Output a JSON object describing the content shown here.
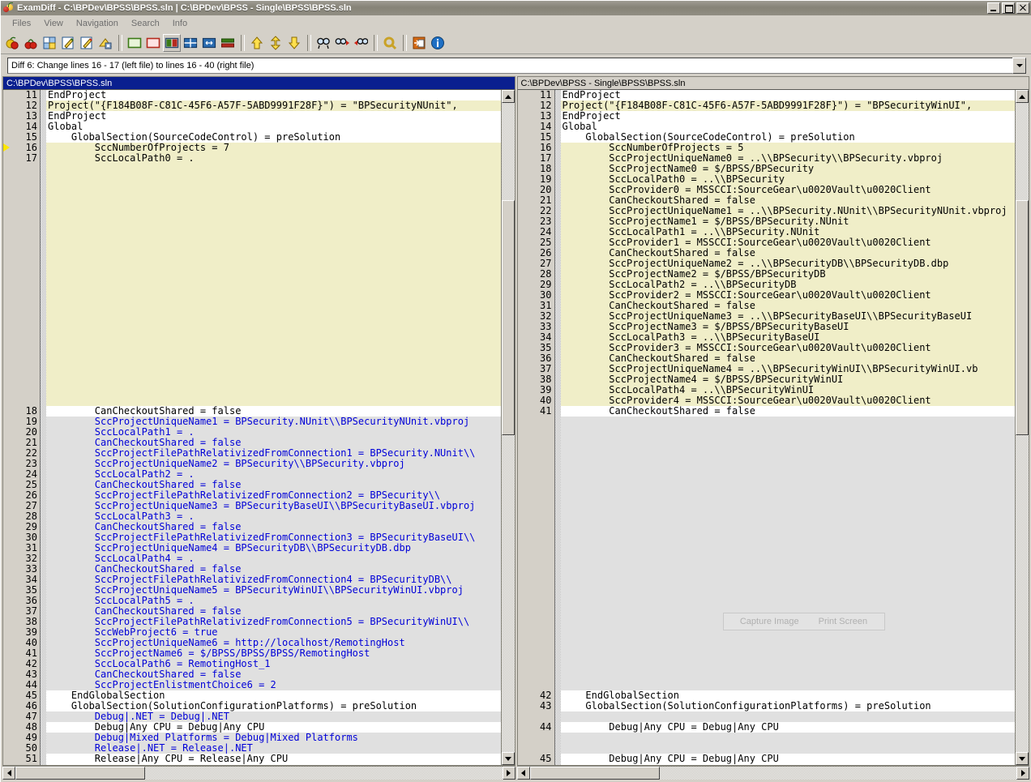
{
  "window": {
    "title": "ExamDiff - C:\\BPDev\\BPSS\\BPSS.sln  |  C:\\BPDev\\BPSS - Single\\BPSS\\BPSS.sln",
    "minimize_label": "Minimize",
    "maximize_label": "Maximize",
    "close_label": "Close"
  },
  "menu": {
    "items": [
      {
        "label": "Files"
      },
      {
        "label": "View"
      },
      {
        "label": "Navigation"
      },
      {
        "label": "Search"
      },
      {
        "label": "Info"
      }
    ]
  },
  "toolbar": {
    "buttons": [
      {
        "name": "compare-files-icon",
        "title": "Compare Files"
      },
      {
        "name": "compare-directories-icon",
        "title": "Compare Directories"
      },
      {
        "name": "recompare-icon",
        "title": "Recompare"
      },
      {
        "name": "edit-left-file-icon",
        "title": "Edit Left File"
      },
      {
        "name": "edit-right-file-icon",
        "title": "Edit Right File"
      },
      {
        "name": "save-icon",
        "title": "Save"
      },
      {
        "name": "view-left-only-icon",
        "title": "View Left File Only"
      },
      {
        "name": "view-right-only-icon",
        "title": "View Right File Only"
      },
      {
        "name": "view-side-by-side-icon",
        "title": "Side-by-Side View"
      },
      {
        "name": "view-grid-icon",
        "title": "Grid View"
      },
      {
        "name": "view-horizontal-split-icon",
        "title": "Horizontal Split"
      },
      {
        "name": "view-stacked-icon",
        "title": "Stacked View"
      },
      {
        "name": "first-diff-icon",
        "title": "First Difference"
      },
      {
        "name": "next-diff-icon",
        "title": "Next Difference"
      },
      {
        "name": "last-diff-icon",
        "title": "Last Difference"
      },
      {
        "name": "find-icon",
        "title": "Find"
      },
      {
        "name": "find-next-icon",
        "title": "Find Next"
      },
      {
        "name": "find-previous-icon",
        "title": "Find Previous"
      },
      {
        "name": "options-icon",
        "title": "Options"
      },
      {
        "name": "exit-icon",
        "title": "Exit"
      },
      {
        "name": "about-icon",
        "title": "About"
      }
    ],
    "selected_index": 8
  },
  "diff_status": {
    "text": "Diff 6: Change lines 16 - 17 (left file) to lines 16 - 40 (right file)"
  },
  "left_pane": {
    "path": "C:\\BPDev\\BPSS\\BPSS.sln",
    "active": true,
    "lines": [
      {
        "n": "11",
        "text": "EndProject",
        "type": "same"
      },
      {
        "n": "12",
        "text": "Project(\"{F184B08F-C81C-45F6-A57F-5ABD9991F28F}\") = \"BPSecurityNUnit\",",
        "type": "inline"
      },
      {
        "n": "13",
        "text": "EndProject",
        "type": "same"
      },
      {
        "n": "14",
        "text": "Global",
        "type": "same"
      },
      {
        "n": "15",
        "text": "    GlobalSection(SourceCodeControl) = preSolution",
        "type": "same"
      },
      {
        "n": "16",
        "text": "        SccNumberOfProjects = 7",
        "type": "chg"
      },
      {
        "n": "17",
        "text": "        SccLocalPath0 = .",
        "type": "chg"
      },
      {
        "n": "18",
        "text": "        CanCheckoutShared = false",
        "type": "same"
      },
      {
        "n": "19",
        "text": "        SccProjectUniqueName1 = BPSecurity.NUnit\\\\BPSecurityNUnit.vbproj",
        "type": "del"
      },
      {
        "n": "20",
        "text": "        SccLocalPath1 = .",
        "type": "del"
      },
      {
        "n": "21",
        "text": "        CanCheckoutShared = false",
        "type": "del"
      },
      {
        "n": "22",
        "text": "        SccProjectFilePathRelativizedFromConnection1 = BPSecurity.NUnit\\\\",
        "type": "del"
      },
      {
        "n": "23",
        "text": "        SccProjectUniqueName2 = BPSecurity\\\\BPSecurity.vbproj",
        "type": "del"
      },
      {
        "n": "24",
        "text": "        SccLocalPath2 = .",
        "type": "del"
      },
      {
        "n": "25",
        "text": "        CanCheckoutShared = false",
        "type": "del"
      },
      {
        "n": "26",
        "text": "        SccProjectFilePathRelativizedFromConnection2 = BPSecurity\\\\",
        "type": "del"
      },
      {
        "n": "27",
        "text": "        SccProjectUniqueName3 = BPSecurityBaseUI\\\\BPSecurityBaseUI.vbproj",
        "type": "del"
      },
      {
        "n": "28",
        "text": "        SccLocalPath3 = .",
        "type": "del"
      },
      {
        "n": "29",
        "text": "        CanCheckoutShared = false",
        "type": "del"
      },
      {
        "n": "30",
        "text": "        SccProjectFilePathRelativizedFromConnection3 = BPSecurityBaseUI\\\\",
        "type": "del"
      },
      {
        "n": "31",
        "text": "        SccProjectUniqueName4 = BPSecurityDB\\\\BPSecurityDB.dbp",
        "type": "del"
      },
      {
        "n": "32",
        "text": "        SccLocalPath4 = .",
        "type": "del"
      },
      {
        "n": "33",
        "text": "        CanCheckoutShared = false",
        "type": "del"
      },
      {
        "n": "34",
        "text": "        SccProjectFilePathRelativizedFromConnection4 = BPSecurityDB\\\\",
        "type": "del"
      },
      {
        "n": "35",
        "text": "        SccProjectUniqueName5 = BPSecurityWinUI\\\\BPSecurityWinUI.vbproj",
        "type": "del"
      },
      {
        "n": "36",
        "text": "        SccLocalPath5 = .",
        "type": "del"
      },
      {
        "n": "37",
        "text": "        CanCheckoutShared = false",
        "type": "del"
      },
      {
        "n": "38",
        "text": "        SccProjectFilePathRelativizedFromConnection5 = BPSecurityWinUI\\\\",
        "type": "del"
      },
      {
        "n": "39",
        "text": "        SccWebProject6 = true",
        "type": "del"
      },
      {
        "n": "40",
        "text": "        SccProjectUniqueName6 = http://localhost/RemotingHost",
        "type": "del"
      },
      {
        "n": "41",
        "text": "        SccProjectName6 = $/BPSS/BPSS/BPSS/RemotingHost",
        "type": "del"
      },
      {
        "n": "42",
        "text": "        SccLocalPath6 = RemotingHost_1",
        "type": "del"
      },
      {
        "n": "43",
        "text": "        CanCheckoutShared = false",
        "type": "del"
      },
      {
        "n": "44",
        "text": "        SccProjectEnlistmentChoice6 = 2",
        "type": "del"
      },
      {
        "n": "45",
        "text": "    EndGlobalSection",
        "type": "same"
      },
      {
        "n": "46",
        "text": "    GlobalSection(SolutionConfigurationPlatforms) = preSolution",
        "type": "same"
      },
      {
        "n": "47",
        "text": "        Debug|.NET = Debug|.NET",
        "type": "del"
      },
      {
        "n": "48",
        "text": "        Debug|Any CPU = Debug|Any CPU",
        "type": "same"
      },
      {
        "n": "49",
        "text": "        Debug|Mixed Platforms = Debug|Mixed Platforms",
        "type": "del"
      },
      {
        "n": "50",
        "text": "        Release|.NET = Release|.NET",
        "type": "del"
      },
      {
        "n": "51",
        "text": "        Release|Any CPU = Release|Any CPU",
        "type": "same"
      },
      {
        "n": "52",
        "text": "",
        "type": "same"
      }
    ]
  },
  "right_pane": {
    "path": "C:\\BPDev\\BPSS - Single\\BPSS\\BPSS.sln",
    "active": false,
    "lines": [
      {
        "n": "11",
        "text": "EndProject",
        "type": "same"
      },
      {
        "n": "12",
        "text": "Project(\"{F184B08F-C81C-45F6-A57F-5ABD9991F28F}\") = \"BPSecurityWinUI\",",
        "type": "inline"
      },
      {
        "n": "13",
        "text": "EndProject",
        "type": "same"
      },
      {
        "n": "14",
        "text": "Global",
        "type": "same"
      },
      {
        "n": "15",
        "text": "    GlobalSection(SourceCodeControl) = preSolution",
        "type": "same"
      },
      {
        "n": "16",
        "text": "        SccNumberOfProjects = 5",
        "type": "chg"
      },
      {
        "n": "17",
        "text": "        SccProjectUniqueName0 = ..\\\\BPSecurity\\\\BPSecurity.vbproj",
        "type": "chg"
      },
      {
        "n": "18",
        "text": "        SccProjectName0 = $/BPSS/BPSecurity",
        "type": "chg"
      },
      {
        "n": "19",
        "text": "        SccLocalPath0 = ..\\\\BPSecurity",
        "type": "chg"
      },
      {
        "n": "20",
        "text": "        SccProvider0 = MSSCCI:SourceGear\\u0020Vault\\u0020Client",
        "type": "chg"
      },
      {
        "n": "21",
        "text": "        CanCheckoutShared = false",
        "type": "chg"
      },
      {
        "n": "22",
        "text": "        SccProjectUniqueName1 = ..\\\\BPSecurity.NUnit\\\\BPSecurityNUnit.vbproj",
        "type": "chg"
      },
      {
        "n": "23",
        "text": "        SccProjectName1 = $/BPSS/BPSecurity.NUnit",
        "type": "chg"
      },
      {
        "n": "24",
        "text": "        SccLocalPath1 = ..\\\\BPSecurity.NUnit",
        "type": "chg"
      },
      {
        "n": "25",
        "text": "        SccProvider1 = MSSCCI:SourceGear\\u0020Vault\\u0020Client",
        "type": "chg"
      },
      {
        "n": "26",
        "text": "        CanCheckoutShared = false",
        "type": "chg"
      },
      {
        "n": "27",
        "text": "        SccProjectUniqueName2 = ..\\\\BPSecurityDB\\\\BPSecurityDB.dbp",
        "type": "chg"
      },
      {
        "n": "28",
        "text": "        SccProjectName2 = $/BPSS/BPSecurityDB",
        "type": "chg"
      },
      {
        "n": "29",
        "text": "        SccLocalPath2 = ..\\\\BPSecurityDB",
        "type": "chg"
      },
      {
        "n": "30",
        "text": "        SccProvider2 = MSSCCI:SourceGear\\u0020Vault\\u0020Client",
        "type": "chg"
      },
      {
        "n": "31",
        "text": "        CanCheckoutShared = false",
        "type": "chg"
      },
      {
        "n": "32",
        "text": "        SccProjectUniqueName3 = ..\\\\BPSecurityBaseUI\\\\BPSecurityBaseUI",
        "type": "chg"
      },
      {
        "n": "33",
        "text": "        SccProjectName3 = $/BPSS/BPSecurityBaseUI",
        "type": "chg"
      },
      {
        "n": "34",
        "text": "        SccLocalPath3 = ..\\\\BPSecurityBaseUI",
        "type": "chg"
      },
      {
        "n": "35",
        "text": "        SccProvider3 = MSSCCI:SourceGear\\u0020Vault\\u0020Client",
        "type": "chg"
      },
      {
        "n": "36",
        "text": "        CanCheckoutShared = false",
        "type": "chg"
      },
      {
        "n": "37",
        "text": "        SccProjectUniqueName4 = ..\\\\BPSecurityWinUI\\\\BPSecurityWinUI.vb",
        "type": "chg"
      },
      {
        "n": "38",
        "text": "        SccProjectName4 = $/BPSS/BPSecurityWinUI",
        "type": "chg"
      },
      {
        "n": "39",
        "text": "        SccLocalPath4 = ..\\\\BPSecurityWinUI",
        "type": "chg"
      },
      {
        "n": "40",
        "text": "        SccProvider4 = MSSCCI:SourceGear\\u0020Vault\\u0020Client",
        "type": "chg"
      },
      {
        "n": "41",
        "text": "        CanCheckoutShared = false",
        "type": "same"
      },
      {
        "n": "42",
        "text": "    EndGlobalSection",
        "type": "same"
      },
      {
        "n": "43",
        "text": "    GlobalSection(SolutionConfigurationPlatforms) = preSolution",
        "type": "same"
      },
      {
        "n": "44",
        "text": "        Debug|Any CPU = Debug|Any CPU",
        "type": "same"
      },
      {
        "n": "45",
        "text": "        Debug|Any CPU = Debug|Any CPU",
        "type": "same"
      }
    ]
  },
  "ghost_overlay": {
    "capture_image_label": "Capture Image",
    "print_screen_label": "Print Screen"
  },
  "colors": {
    "changed_bg": "#f0eec8",
    "deleted_bg": "#e0e0e0",
    "deleted_fg": "#0000d8",
    "active_header_bg": "#0a1f8f",
    "window_bg": "#d4d0c8",
    "marker": "#ffe600"
  }
}
